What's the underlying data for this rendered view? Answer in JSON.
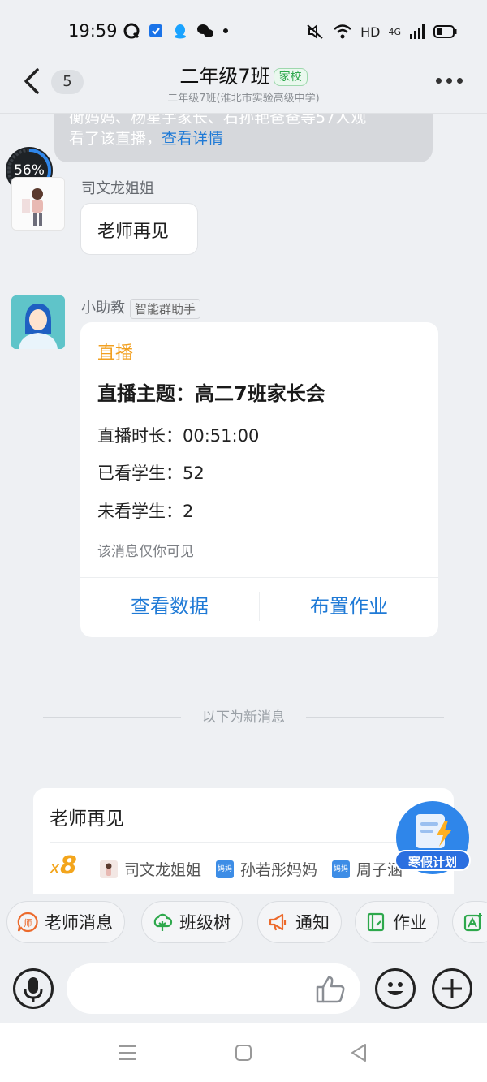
{
  "status_bar": {
    "time": "19:59",
    "network_label": "HD",
    "signal_label": "4G",
    "icons": [
      "qq-browser-icon",
      "shield-icon",
      "qq-icon",
      "wechat-icon",
      "dot-icon",
      "mute-icon",
      "wifi-icon",
      "signal-icon",
      "battery-icon"
    ]
  },
  "header": {
    "unread_count": "5",
    "title": "二年级7班",
    "tag": "家校",
    "subtitle": "二年级7班(淮北市实验高级中学)"
  },
  "notice": {
    "line1": "衡妈妈、杨星宇家长、石孙艳爸爸等57人观",
    "line2_prefix": "看了该直播，",
    "link": "查看详情"
  },
  "progress": {
    "label": "56%",
    "value": 0.56
  },
  "messages": [
    {
      "sender": "司文龙姐姐",
      "text": "老师再见"
    },
    {
      "sender": "小助教",
      "role_tag": "智能群助手",
      "card": {
        "label": "直播",
        "topic": "直播主题：高二7班家长会",
        "duration": "直播时长：00:51:00",
        "watched": "已看学生：52",
        "not_watched": "未看学生：2",
        "note": "该消息仅你可见",
        "btn_data": "查看数据",
        "btn_homework": "布置作业"
      }
    }
  ],
  "separator": "以下为新消息",
  "repeat_card": {
    "text": "老师再见",
    "count_prefix": "x",
    "count": "8",
    "people": [
      "司文龙姐姐",
      "孙若彤妈妈",
      "周子涵"
    ],
    "mini_avatar_text": "妈妈"
  },
  "fab": {
    "label": "寒假计划"
  },
  "chips": [
    "老师消息",
    "班级树",
    "通知",
    "作业"
  ],
  "colors": {
    "link": "#1f7ad6",
    "accent": "#f2a020",
    "tag_green": "#2ea84c",
    "fab_blue": "#2f86ea"
  }
}
